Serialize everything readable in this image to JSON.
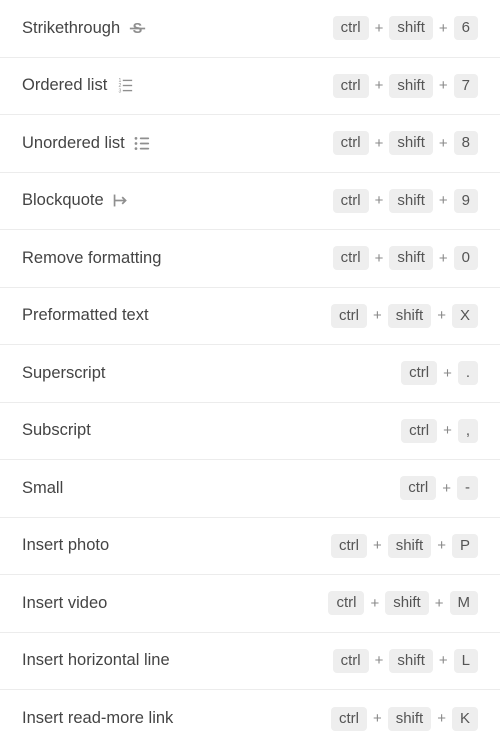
{
  "plus_separator": "+",
  "shortcuts": [
    {
      "id": "strikethrough",
      "label": "Strikethrough",
      "icon": "strikethrough-icon",
      "keys": [
        "ctrl",
        "shift",
        "6"
      ]
    },
    {
      "id": "ordered-list",
      "label": "Ordered list",
      "icon": "ordered-list-icon",
      "keys": [
        "ctrl",
        "shift",
        "7"
      ]
    },
    {
      "id": "unordered-list",
      "label": "Unordered list",
      "icon": "unordered-list-icon",
      "keys": [
        "ctrl",
        "shift",
        "8"
      ]
    },
    {
      "id": "blockquote",
      "label": "Blockquote",
      "icon": "blockquote-icon",
      "keys": [
        "ctrl",
        "shift",
        "9"
      ]
    },
    {
      "id": "remove-formatting",
      "label": "Remove formatting",
      "icon": null,
      "keys": [
        "ctrl",
        "shift",
        "0"
      ]
    },
    {
      "id": "preformatted-text",
      "label": "Preformatted text",
      "icon": null,
      "keys": [
        "ctrl",
        "shift",
        "X"
      ]
    },
    {
      "id": "superscript",
      "label": "Superscript",
      "icon": null,
      "keys": [
        "ctrl",
        "."
      ]
    },
    {
      "id": "subscript",
      "label": "Subscript",
      "icon": null,
      "keys": [
        "ctrl",
        ","
      ]
    },
    {
      "id": "small",
      "label": "Small",
      "icon": null,
      "keys": [
        "ctrl",
        "-"
      ]
    },
    {
      "id": "insert-photo",
      "label": "Insert photo",
      "icon": null,
      "keys": [
        "ctrl",
        "shift",
        "P"
      ]
    },
    {
      "id": "insert-video",
      "label": "Insert video",
      "icon": null,
      "keys": [
        "ctrl",
        "shift",
        "M"
      ]
    },
    {
      "id": "insert-hr",
      "label": "Insert horizontal line",
      "icon": null,
      "keys": [
        "ctrl",
        "shift",
        "L"
      ]
    },
    {
      "id": "insert-readmore",
      "label": "Insert read-more link",
      "icon": null,
      "keys": [
        "ctrl",
        "shift",
        "K"
      ]
    }
  ]
}
